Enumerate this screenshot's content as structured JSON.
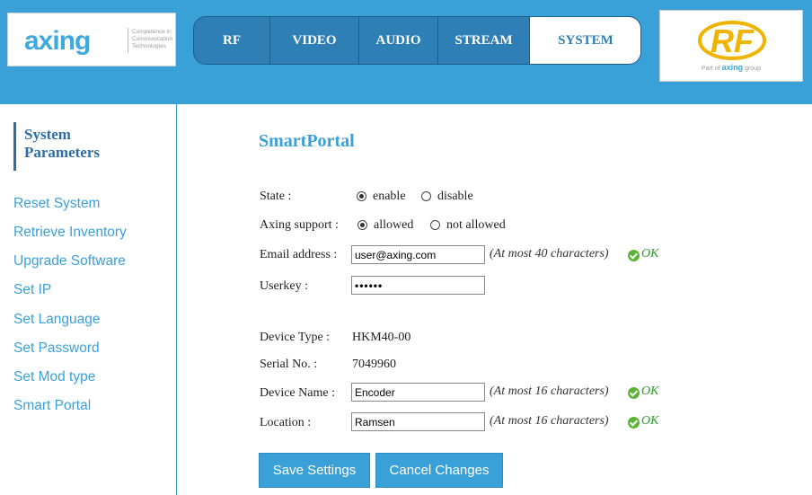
{
  "header": {
    "logo_text": "axing",
    "logo_tagline": "Competence in Communication Technologies",
    "nav": [
      "RF",
      "VIDEO",
      "AUDIO",
      "STREAM",
      "SYSTEM"
    ],
    "active_nav": "SYSTEM",
    "partner_logo_text": "RF",
    "partner_sub_prefix": "Part of",
    "partner_sub_brand": "axing",
    "partner_sub_suffix": "group"
  },
  "sidebar": {
    "title_line1": "System",
    "title_line2": "Parameters",
    "items": [
      "Reset System",
      "Retrieve Inventory",
      "Upgrade Software",
      "Set IP",
      "Set Language",
      "Set Password",
      "Set Mod type",
      "Smart Portal"
    ]
  },
  "main": {
    "title": "SmartPortal",
    "state": {
      "label": "State :",
      "options": [
        "enable",
        "disable"
      ],
      "selected": "enable"
    },
    "support": {
      "label": "Axing support :",
      "options": [
        "allowed",
        "not allowed"
      ],
      "selected": "allowed"
    },
    "email": {
      "label": "Email address :",
      "value": "user@axing.com",
      "hint": "(At most 40 characters)",
      "status": "OK"
    },
    "userkey": {
      "label": "Userkey :",
      "value": "••••••"
    },
    "device_type": {
      "label": "Device Type :",
      "value": "HKM40-00"
    },
    "serial": {
      "label": "Serial No. :",
      "value": "7049960"
    },
    "device_name": {
      "label": "Device Name :",
      "value": "Encoder",
      "hint": "(At most 16 characters)",
      "status": "OK"
    },
    "location": {
      "label": "Location :",
      "value": "Ramsen",
      "hint": "(At most 16 characters)",
      "status": "OK"
    },
    "save_label": "Save Settings",
    "cancel_label": "Cancel Changes"
  },
  "colors": {
    "accent": "#3aa0d8",
    "nav_bg": "#2e7fb5",
    "ok": "#5bb534"
  }
}
